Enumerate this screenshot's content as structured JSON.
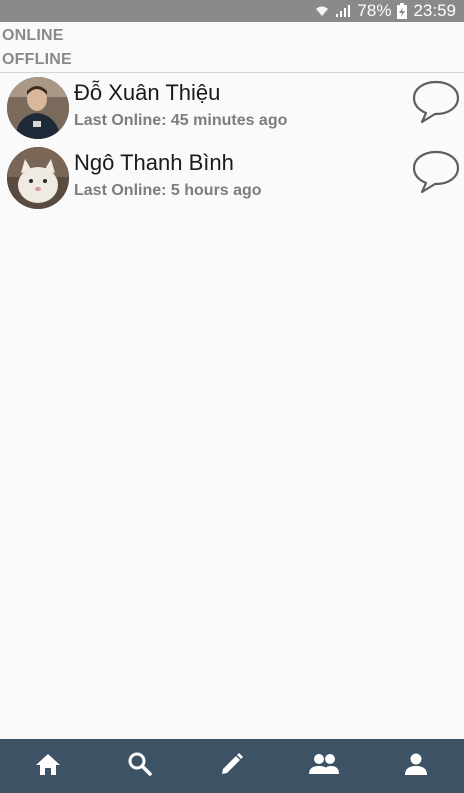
{
  "status_bar": {
    "battery": "78%",
    "time": "23:59",
    "icons": [
      "wifi-icon",
      "signal-icon",
      "battery-charging-icon"
    ]
  },
  "sections": {
    "online_label": "ONLINE",
    "offline_label": "OFFLINE"
  },
  "friends": [
    {
      "name": "Đỗ Xuân Thiệu",
      "last_online": "Last Online: 45 minutes ago",
      "avatar": "avatar-photo-man",
      "action_icon": "chat-bubble-icon"
    },
    {
      "name": "Ngô Thanh Bình",
      "last_online": "Last Online: 5 hours ago",
      "avatar": "avatar-photo-cat",
      "action_icon": "chat-bubble-icon"
    }
  ],
  "bottom_nav": {
    "items": [
      "home-icon",
      "search-icon",
      "pencil-icon",
      "friends-icon",
      "profile-icon"
    ]
  },
  "colors": {
    "status_bar": "#8a8a8a",
    "nav_background": "#3d5365",
    "nav_icon": "#ffffff",
    "section_label": "#8a8a8a",
    "secondary_text": "#7d7d7d"
  }
}
